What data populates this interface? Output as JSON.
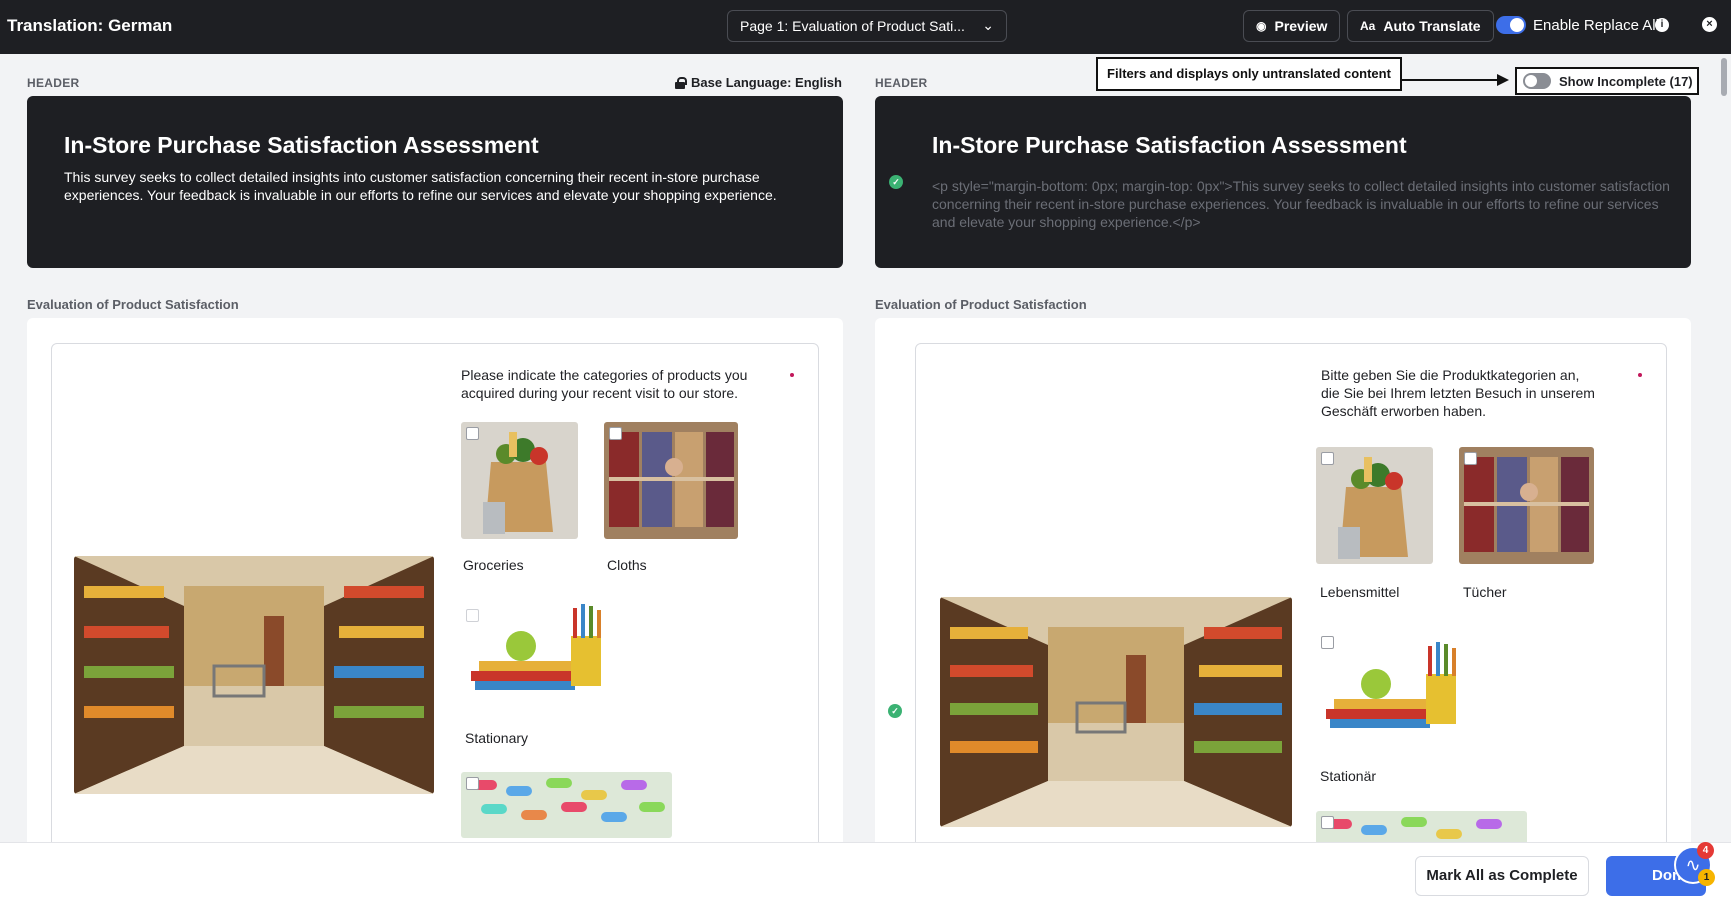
{
  "header": {
    "title": "Translation: German",
    "page_select": "Page 1: Evaluation of Product Sati...",
    "preview_label": "Preview",
    "auto_translate_label": "Auto Translate",
    "replace_all_label": "Enable Replace All",
    "replace_all_enabled": true
  },
  "left": {
    "section_label": "HEADER",
    "base_language": "Base Language: English",
    "title": "In-Store Purchase Satisfaction Assessment",
    "description": "This survey seeks to collect detailed insights into customer satisfaction concerning their recent in-store purchase experiences. Your feedback is invaluable in our efforts to refine our services and elevate your shopping experience.",
    "page_label": "Evaluation of Product Satisfaction",
    "question": "Please indicate the categories of products you acquired during your recent visit to our store.",
    "options": [
      "Groceries",
      "Cloths",
      "Stationary"
    ]
  },
  "right": {
    "section_label": "HEADER",
    "title": "In-Store Purchase Satisfaction Assessment",
    "description": "<p style=\"margin-bottom: 0px; margin-top: 0px\">This survey seeks to collect detailed insights into customer satisfaction concerning their recent in-store purchase experiences. Your feedback is invaluable in our efforts to refine our services and elevate your shopping experience.</p>",
    "page_label": "Evaluation of Product Satisfaction",
    "question": "Bitte geben Sie die Produktkategorien an, die Sie bei Ihrem letzten Besuch in unserem Geschäft erworben haben.",
    "options": [
      "Lebensmittel",
      "Tücher",
      "Stationär"
    ]
  },
  "annotation": {
    "callout": "Filters and displays only untranslated content",
    "show_incomplete_label": "Show Incomplete (17)",
    "show_incomplete_enabled": false
  },
  "footer": {
    "mark_all_label": "Mark All as Complete",
    "done_label": "Done",
    "badge_red": "4",
    "badge_yellow": "1"
  },
  "icons": {
    "preview": "eye-icon",
    "auto_translate": "translate-icon",
    "info": "info-icon",
    "close": "close-icon",
    "lock": "lock-icon",
    "check": "check-circle-icon",
    "help": "activity-icon"
  },
  "colors": {
    "accent": "#3d6ee8",
    "dark": "#1e1f23",
    "success": "#3bb273",
    "required": "#c2185b"
  }
}
